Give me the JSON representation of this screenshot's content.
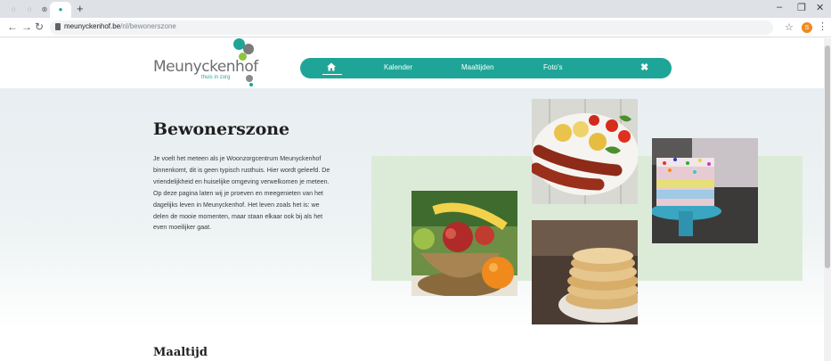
{
  "browser": {
    "url_host": "meunyckenhof.be",
    "url_path": "/nl/bewonerszone",
    "profile_initial": "S",
    "new_tab_label": "+"
  },
  "site": {
    "logo_name": "Meunyckenhof",
    "logo_tagline": "thuis in zorg",
    "nav": {
      "home_label": "Home",
      "items": [
        "Kalender",
        "Maaltijden",
        "Foto's"
      ]
    }
  },
  "hero": {
    "title": "Bewonerszone",
    "intro": "Je voelt het meteen als je Woonzorgcentrum Meunyckenhof binnenkomt, dit is geen typisch rusthuis. Hier wordt geleefd. De vriendelijkheid en huiselijke omgeving verwelkomen je meteen. Op deze pagina laten wij je proeven en meegenieten van het dagelijks leven in Meunyckenhof. Het leven zoals het is: we delen de mooie momenten, maar staan elkaar ook bij als het even moeilijker gaat."
  },
  "photos": [
    "fruit-basket",
    "sausages-potatoes",
    "pancakes",
    "sprinkle-cake"
  ],
  "section2": {
    "title": "Maaltijd"
  },
  "colors": {
    "brand_teal": "#1fa597",
    "band_green": "#dcebd8"
  }
}
